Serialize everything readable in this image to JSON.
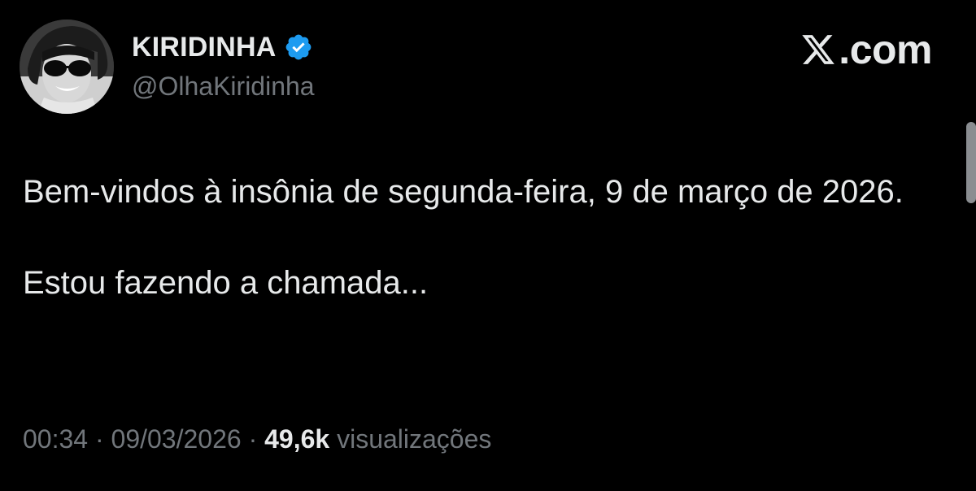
{
  "tweet": {
    "author": {
      "display_name": "KIRIDINHA",
      "handle": "@OlhaKiridinha",
      "verified": true,
      "verified_icon": "verified-badge-icon",
      "verified_color": "#1d9bf0"
    },
    "brand": {
      "icon": "x-logo-icon",
      "text": ".com"
    },
    "text_paragraphs": [
      "Bem-vindos à insônia de segunda-feira, 9 de março de 2026.",
      "Estou fazendo a chamada..."
    ],
    "meta": {
      "time": "00:34",
      "separator": "·",
      "date": "09/03/2026",
      "views_count": "49,6k",
      "views_label": "visualizações"
    }
  },
  "colors": {
    "background": "#000000",
    "primary_text": "#e7e9ea",
    "secondary_text": "#71767b",
    "accent": "#1d9bf0"
  }
}
